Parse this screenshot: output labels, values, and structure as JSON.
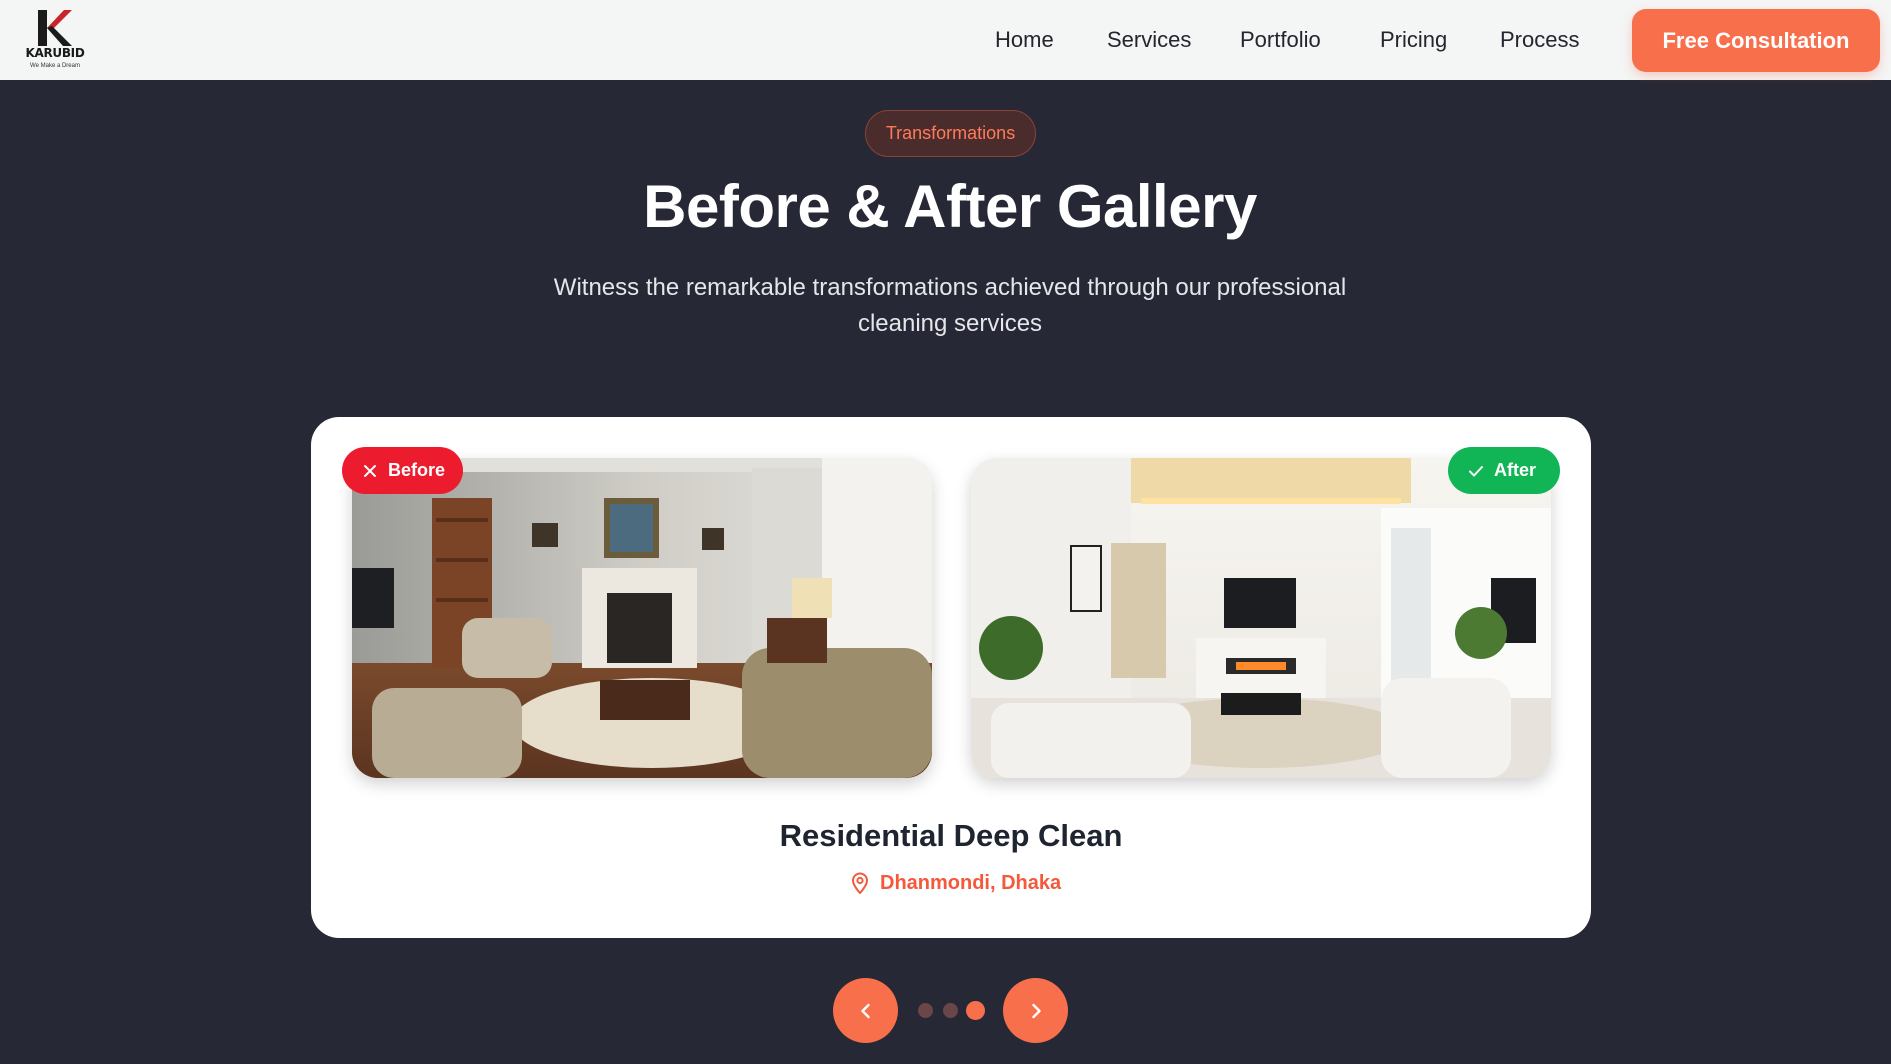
{
  "header": {
    "logo": {
      "brand": "KARUBID",
      "tagline": "We Make a Dream"
    },
    "nav": [
      "Home",
      "Services",
      "Portfolio",
      "Pricing",
      "Process"
    ],
    "cta_label": "Free Consultation"
  },
  "hero": {
    "badge": "Transformations",
    "title": "Before & After Gallery",
    "subtitle": "Witness the remarkable transformations achieved through our professional cleaning services"
  },
  "gallery": {
    "before_label": "Before",
    "after_label": "After",
    "project_title": "Residential Deep Clean",
    "location": "Dhanmondi, Dhaka",
    "slide_count": 3,
    "active_slide": 3
  },
  "colors": {
    "accent": "#f86f4c",
    "before": "#ec1c2e",
    "after": "#11b556",
    "background": "#262835"
  },
  "icons": {
    "before_badge": "x-icon",
    "after_badge": "check-icon",
    "location": "map-pin-icon",
    "prev": "chevron-left-icon",
    "next": "chevron-right-icon"
  }
}
